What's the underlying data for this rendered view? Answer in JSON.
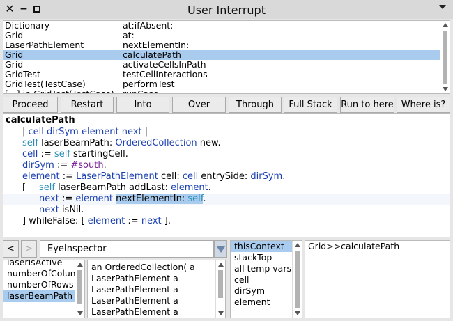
{
  "window": {
    "title": "User Interrupt"
  },
  "stack": {
    "rows": [
      {
        "cls": "Dictionary",
        "selector": "at:ifAbsent:",
        "selected": false
      },
      {
        "cls": "Grid",
        "selector": "at:",
        "selected": false
      },
      {
        "cls": "LaserPathElement",
        "selector": "nextElementIn:",
        "selected": false
      },
      {
        "cls": "Grid",
        "selector": "calculatePath",
        "selected": true
      },
      {
        "cls": "Grid",
        "selector": "activateCellsInPath",
        "selected": false
      },
      {
        "cls": "GridTest",
        "selector": "testCellInteractions",
        "selected": false
      },
      {
        "cls": "GridTest(TestCase)",
        "selector": "performTest",
        "selected": false
      },
      {
        "cls": "[...] in GridTest(TestCase)",
        "selector": "runCase",
        "selected": false
      }
    ]
  },
  "toolbar": {
    "proceed": "Proceed",
    "restart": "Restart",
    "into": "Into",
    "over": "Over",
    "through": "Through",
    "full_stack": "Full Stack",
    "run_to_here": "Run to here",
    "where_is": "Where is?"
  },
  "code": {
    "method_name": "calculatePath",
    "l1_bar1": "| ",
    "l1_temps": "cell dirSym element next",
    "l1_bar2": " |",
    "l2_self": "self",
    "l2_mid": " laserBeamPath: ",
    "l2_cls": "OrderedCollection",
    "l2_end": " new.",
    "l3_var": "cell",
    "l3_assign": " := ",
    "l3_self": "self",
    "l3_end": " startingCell.",
    "l4_var": "dirSym",
    "l4_assign": " := ",
    "l4_sym": "#south",
    "l4_end": ".",
    "l5_var": "element",
    "l5_assign": " := ",
    "l5_cls": "LaserPathElement",
    "l5_kw1": " cell: ",
    "l5_cell": "cell",
    "l5_kw2": " entrySide: ",
    "l5_dir": "dirSym",
    "l5_end": ".",
    "l6_open": "[",
    "l6_self": "self",
    "l6_mid": " laserBeamPath addLast: ",
    "l6_el": "element",
    "l6_end": ".",
    "l7_var": "next",
    "l7_assign": " := ",
    "l7_el": "element",
    "l7_sp": " ",
    "l7_sel": "nextElementIn: ",
    "l7_self": "self",
    "l7_end": ".",
    "l8_var": "next",
    "l8_end": " isNil.",
    "l9_a": "] whileFalse: [ ",
    "l9_el": "element",
    "l9_assign": " := ",
    "l9_next": "next",
    "l9_end": " ]."
  },
  "inspector": {
    "back_label": "<",
    "forward_label": ">",
    "selected_inspector": "EyeInspector",
    "attributes": [
      {
        "label": "laserIsActive",
        "selected": false
      },
      {
        "label": "numberOfColumns",
        "selected": false
      },
      {
        "label": "numberOfRows",
        "selected": false
      },
      {
        "label": "laserBeamPath",
        "selected": true
      }
    ],
    "values": [
      "an OrderedCollection( a",
      "LaserPathElement a",
      "LaserPathElement a",
      "LaserPathElement a",
      "LaserPathElement a"
    ]
  },
  "context": {
    "items": [
      {
        "label": "thisContext",
        "selected": true
      },
      {
        "label": "stackTop",
        "selected": false
      },
      {
        "label": "all temp vars",
        "selected": false
      },
      {
        "label": "cell",
        "selected": false
      },
      {
        "label": "dirSym",
        "selected": false
      },
      {
        "label": "element",
        "selected": false
      }
    ],
    "value": "Grid>>calculatePath"
  },
  "colors": {
    "selection": "#a9cbee",
    "keyword_blue": "#1a3fb0",
    "self_teal": "#2a8fb8",
    "symbol_purple": "#7a2596"
  }
}
